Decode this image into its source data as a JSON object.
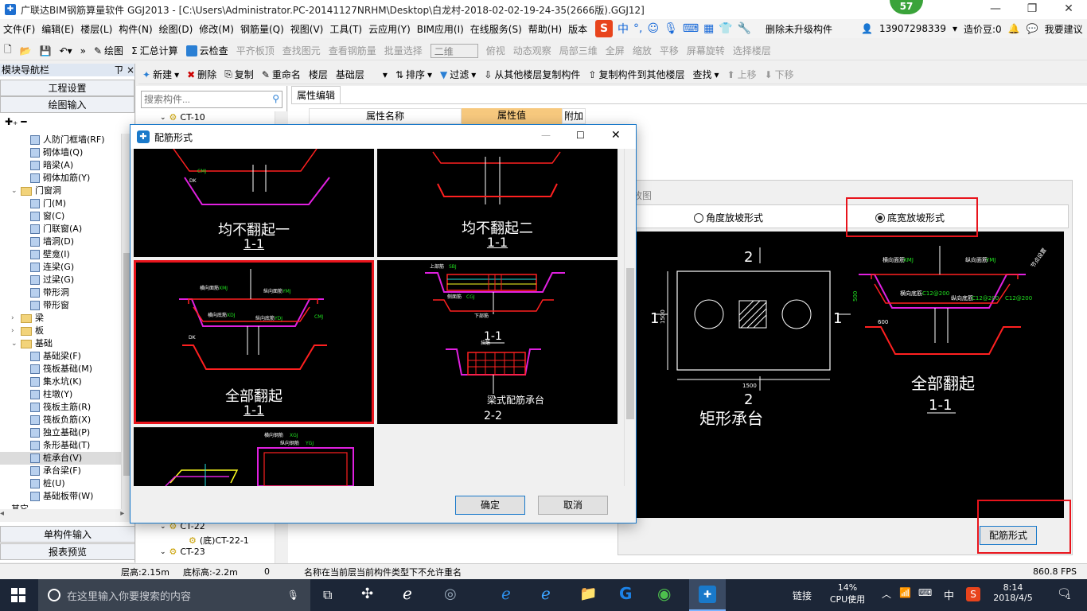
{
  "titlebar": {
    "title": "广联达BIM钢筋算量软件 GGJ2013 - [C:\\Users\\Administrator.PC-20141127NRHM\\Desktop\\白龙村-2018-02-02-19-24-35(2666版).GGJ12]",
    "badge": "57"
  },
  "menu": {
    "items": [
      "文件(F)",
      "编辑(E)",
      "楼层(L)",
      "构件(N)",
      "绘图(D)",
      "修改(M)",
      "钢筋量(Q)",
      "视图(V)",
      "工具(T)",
      "云应用(Y)",
      "BIM应用(I)",
      "在线服务(S)",
      "帮助(H)",
      "版本"
    ],
    "ime_cn": "中",
    "delete_unupgraded": "删除未升级构件",
    "phone": "13907298339",
    "price_bean": "造价豆:0",
    "suggest": "我要建议"
  },
  "toolbar1": {
    "draw": "绘图",
    "sum": "汇总计算",
    "cloud_check": "云检查",
    "flush_top": "平齐板顶",
    "find_elem": "查找图元",
    "view_rebar": "查看钢筋量",
    "batch_select": "批量选择",
    "view_mode": "二维",
    "top_view": "俯视",
    "dynamic_view": "动态观察",
    "local_3d": "局部三维",
    "fullscreen": "全屏",
    "zoom": "缩放",
    "pan": "平移",
    "screen_rotate": "屏幕旋转",
    "select_floor": "选择楼层"
  },
  "toolbar2": {
    "new": "新建",
    "delete": "删除",
    "copy": "复制",
    "rename": "重命名",
    "floor_label": "楼层",
    "floor_value": "基础层",
    "sort": "排序",
    "filter": "过滤",
    "copy_from": "从其他楼层复制构件",
    "copy_to": "复制构件到其他楼层",
    "find": "查找",
    "move_up": "上移",
    "move_down": "下移"
  },
  "leftnav": {
    "header": "模块导航栏",
    "pin": "ㄗ",
    "close": "×",
    "project_settings": "工程设置",
    "drawing_input": "绘图输入",
    "tree": [
      {
        "label": "人防门框墙(RF)",
        "type": "item",
        "indent": 3
      },
      {
        "label": "砌体墙(Q)",
        "type": "item",
        "indent": 3
      },
      {
        "label": "暗梁(A)",
        "type": "item",
        "indent": 3
      },
      {
        "label": "砌体加筋(Y)",
        "type": "item",
        "indent": 3
      },
      {
        "label": "门窗洞",
        "type": "folder",
        "indent": 1,
        "expanded": true
      },
      {
        "label": "门(M)",
        "type": "item",
        "indent": 3
      },
      {
        "label": "窗(C)",
        "type": "item",
        "indent": 3
      },
      {
        "label": "门联窗(A)",
        "type": "item",
        "indent": 3
      },
      {
        "label": "墙洞(D)",
        "type": "item",
        "indent": 3
      },
      {
        "label": "壁龛(I)",
        "type": "item",
        "indent": 3
      },
      {
        "label": "连梁(G)",
        "type": "item",
        "indent": 3
      },
      {
        "label": "过梁(G)",
        "type": "item",
        "indent": 3
      },
      {
        "label": "带形洞",
        "type": "item",
        "indent": 3
      },
      {
        "label": "带形窗",
        "type": "item",
        "indent": 3
      },
      {
        "label": "梁",
        "type": "folder",
        "indent": 1,
        "expanded": false
      },
      {
        "label": "板",
        "type": "folder",
        "indent": 1,
        "expanded": false
      },
      {
        "label": "基础",
        "type": "folder",
        "indent": 1,
        "expanded": true
      },
      {
        "label": "基础梁(F)",
        "type": "item",
        "indent": 3
      },
      {
        "label": "筏板基础(M)",
        "type": "item",
        "indent": 3
      },
      {
        "label": "集水坑(K)",
        "type": "item",
        "indent": 3
      },
      {
        "label": "柱墩(Y)",
        "type": "item",
        "indent": 3
      },
      {
        "label": "筏板主筋(R)",
        "type": "item",
        "indent": 3
      },
      {
        "label": "筏板负筋(X)",
        "type": "item",
        "indent": 3
      },
      {
        "label": "独立基础(P)",
        "type": "item",
        "indent": 3
      },
      {
        "label": "条形基础(T)",
        "type": "item",
        "indent": 3
      },
      {
        "label": "桩承台(V)",
        "type": "item",
        "indent": 3,
        "selected": true
      },
      {
        "label": "承台梁(F)",
        "type": "item",
        "indent": 3
      },
      {
        "label": "桩(U)",
        "type": "item",
        "indent": 3
      },
      {
        "label": "基础板带(W)",
        "type": "item",
        "indent": 3
      }
    ],
    "partial_last": "其它",
    "single_input": "单构件输入",
    "report": "报表预览"
  },
  "complist": {
    "search_placeholder": "搜索构件...",
    "top_item": "CT-10",
    "bottom_items": [
      "CT-22",
      "(底)CT-22-1",
      "CT-23"
    ]
  },
  "props": {
    "tab": "属性编辑",
    "col_name": "属性名称",
    "col_value": "属性值",
    "col_extra": "附加"
  },
  "rebar_panel": {
    "title_partial": "放图",
    "radio_angle": "角度放坡形式",
    "radio_bottom": "底宽放坡形式",
    "selected_radio": "radio_bottom",
    "rect_label": "矩形承台",
    "section_label": "全部翻起",
    "section_sub": "1-1",
    "dim_2": "2",
    "dim_1": "1",
    "dim_1500": "1500",
    "button": "配筋形式",
    "cad_text_1": "横向面筋",
    "cad_text_2": "纵向面筋",
    "cad_text_3": "横向底筋",
    "cad_text_4": "纵向底筋",
    "cad_text_5": "XMJ",
    "cad_text_6": "YMJ",
    "cad_text_7": "C12@200",
    "cad_text_8": "节点设置",
    "cad_text_9": "500",
    "cad_text_10": "600"
  },
  "dialog": {
    "title": "配筋形式",
    "options": [
      {
        "label": "均不翻起一",
        "sub": "1-1"
      },
      {
        "label": "均不翻起二",
        "sub": "1-1"
      },
      {
        "label": "全部翻起",
        "sub": "1-1"
      },
      {
        "label": "梁式配筋承台",
        "sub": "2-2"
      }
    ],
    "selected": "全部翻起",
    "cad_labels": {
      "heng_mian": "横向面筋",
      "zong_mian": "纵向面筋",
      "heng_di": "横向底筋",
      "zong_di": "纵向底筋",
      "xmj": "XMJ",
      "ymj": "YMJ",
      "xdj": "XDJ",
      "ydj": "YDJ",
      "cmj": "CMJ",
      "dk": "DK",
      "shang": "上部筋",
      "sbj": "SBJ",
      "side": "侧面筋",
      "cgj": "CGJ",
      "xia": "下部筋",
      "la": "拉筋",
      "ljd": "LJ",
      "hengxiang": "横向钢筋",
      "xgj": "XGJ",
      "zongxiang": "纵向钢筋",
      "ygj": "YGJ",
      "node_set": "节点设置",
      "v12": "1-1"
    },
    "ok": "确定",
    "cancel": "取消"
  },
  "statusbar": {
    "floor_height": "层高:2.15m",
    "bottom_elev": "底标高:-2.2m",
    "zero": "0",
    "message": "名称在当前层当前构件类型下不允许重名",
    "fps": "860.8 FPS"
  },
  "taskbar": {
    "search_placeholder": "在这里输入你要搜索的内容",
    "link": "链接",
    "cpu_pct": "14%",
    "cpu_label": "CPU使用",
    "ime": "中",
    "time": "8:14",
    "date": "2018/4/5",
    "notif": "1"
  },
  "colors": {
    "accent": "#1979ca",
    "red_highlight": "#e8141c",
    "cad_bg": "#000000",
    "cad_red": "#ff2020",
    "cad_magenta": "#e020e0",
    "cad_green": "#20e020",
    "taskbar": "#1c2637"
  }
}
